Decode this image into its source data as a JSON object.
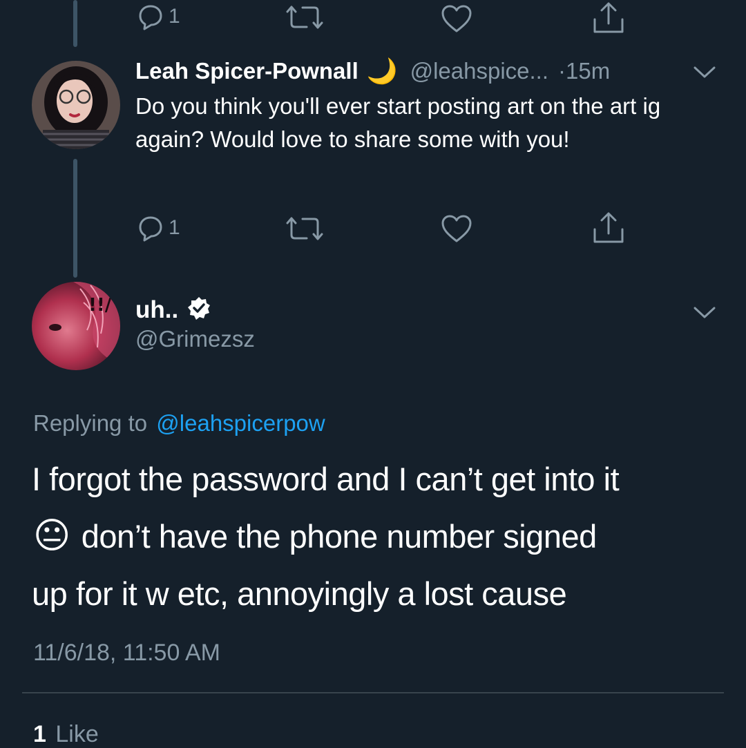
{
  "top_actions": {
    "reply_count": "1"
  },
  "parent_tweet": {
    "display_name": "Leah Spicer-Pownall",
    "name_emoji": "🌙",
    "handle": "@leahspice...",
    "time": "·15m",
    "text": "Do you think you'll ever start posting art on the art ig again? Would love to share some with you!",
    "reply_count": "1"
  },
  "main_tweet": {
    "display_name": "uh..",
    "verified": true,
    "handle": "@Grimezsz",
    "replying_to_prefix": "Replying to",
    "replying_to_handle": "@leahspicerpow",
    "text_line1": "I forgot the password and I can’t get into it",
    "text_emoji": "😐",
    "text_line2": "don’t have the phone number signed",
    "text_line3": "up for it w etc, annoyingly a lost cause",
    "timestamp": "11/6/18, 11:50 AM",
    "likes_count": "1",
    "likes_label": "Like"
  },
  "icons": {
    "reply": "reply-icon",
    "retweet": "retweet-icon",
    "like": "heart-icon",
    "share": "share-icon",
    "more": "chevron-down-icon",
    "verified": "verified-badge-icon"
  },
  "colors": {
    "background": "#15202b",
    "muted": "#8899a6",
    "link": "#1da1f2",
    "divider": "#38444d"
  }
}
